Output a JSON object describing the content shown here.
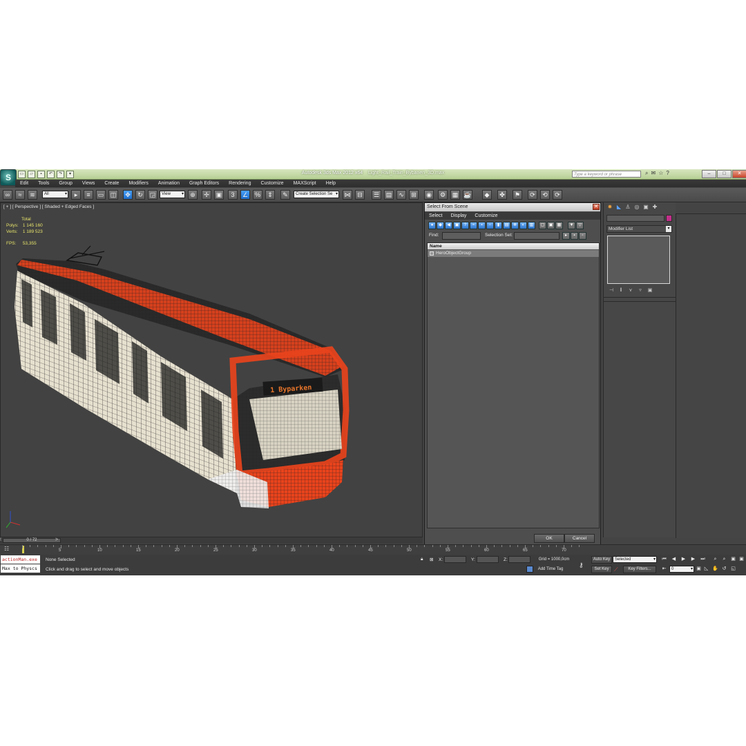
{
  "window": {
    "app_title": "Autodesk 3ds Max  2012 x64",
    "file_name": "Light_Rail_Train_Bybanen_3D.max",
    "search_placeholder": "Type a keyword or phrase"
  },
  "menu": [
    "Edit",
    "Tools",
    "Group",
    "Views",
    "Create",
    "Modifiers",
    "Animation",
    "Graph Editors",
    "Rendering",
    "Customize",
    "MAXScript",
    "Help"
  ],
  "toolbar": {
    "filter_value": "All",
    "refcoord_value": "View",
    "snap_number": "3",
    "selection_set_value": "Create Selection Se"
  },
  "viewport": {
    "label": "[ + ] [ Perspective ] [ Shaded + Edged Faces ]",
    "stats": {
      "total_label": "Total",
      "polys_label": "Polys:",
      "polys_value": "1 145 160",
      "verts_label": "Verts:",
      "verts_value": "1 189 523",
      "fps_label": "FPS:",
      "fps_value": "53,355"
    },
    "destination_sign": "1  Byparken"
  },
  "dialog": {
    "title": "Select From Scene",
    "menu": [
      "Select",
      "Display",
      "Customize"
    ],
    "find_label": "Find:",
    "selection_set_label": "Selection Set:",
    "column_name": "Name",
    "rows": [
      "HeroObjectGroup"
    ],
    "ok_label": "OK",
    "cancel_label": "Cancel"
  },
  "command_panel": {
    "modifier_list_label": "Modifier List"
  },
  "timeline": {
    "slider_text": "0 / 72",
    "ticks": [
      "5",
      "10",
      "15",
      "20",
      "25",
      "30",
      "35",
      "40",
      "45",
      "50",
      "55",
      "60",
      "65",
      "70"
    ]
  },
  "status": {
    "listener_line1": "actionMan.exe",
    "listener_line2": "Max to Physcs",
    "selection_status": "None Selected",
    "prompt": "Click and drag to select and move objects",
    "x_label": "X:",
    "y_label": "Y:",
    "z_label": "Z:",
    "grid": "Grid = 1000,0cm",
    "add_time_tag": "Add Time Tag",
    "auto_key": "Auto Key",
    "set_key": "Set Key",
    "key_mode_value": "Selected",
    "key_filters": "Key Filters...",
    "frame_value": "0"
  },
  "colors": {
    "tram_orange": "#e8431c",
    "viewport_bg": "#424242",
    "stat_yellow": "#e7e46a",
    "object_color": "#c22f8a"
  }
}
